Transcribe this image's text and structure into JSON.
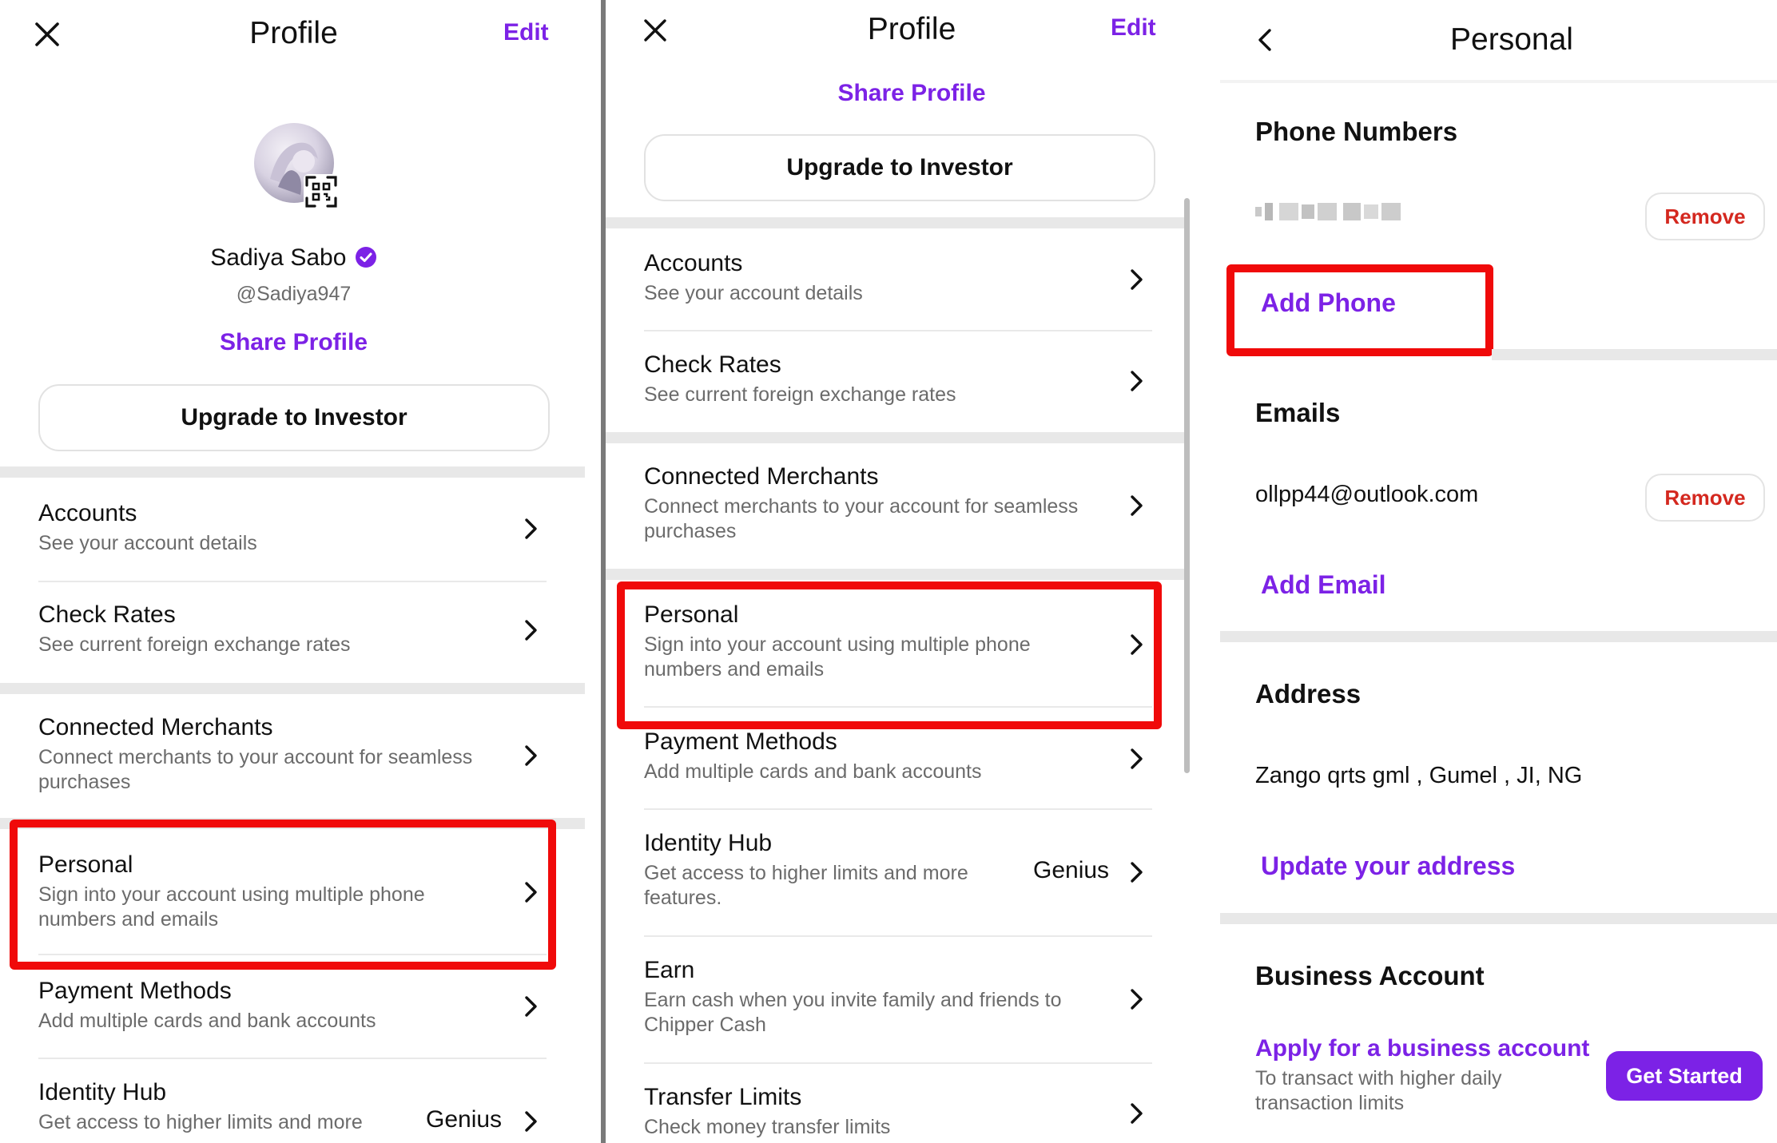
{
  "panel1": {
    "close_icon": "close-icon",
    "title": "Profile",
    "edit_label": "Edit",
    "avatar_icon": "avatar",
    "qr_icon": "qr-code-icon",
    "user_name": "Sadiya Sabo",
    "verified_icon": "verified-badge-icon",
    "username": "@Sadiya947",
    "share_label": "Share Profile",
    "upgrade_label": "Upgrade to Investor",
    "items": [
      {
        "title": "Accounts",
        "subtitle": "See your account details"
      },
      {
        "title": "Check Rates",
        "subtitle": "See current foreign exchange rates"
      },
      {
        "title": "Connected Merchants",
        "subtitle": "Connect merchants to your account for seamless purchases"
      },
      {
        "title": "Personal",
        "subtitle": "Sign into your account using multiple phone numbers and emails"
      },
      {
        "title": "Payment Methods",
        "subtitle": "Add multiple cards and bank accounts"
      },
      {
        "title": "Identity Hub",
        "subtitle": "Get access to higher limits and more",
        "badge": "Genius"
      }
    ]
  },
  "panel2": {
    "title": "Profile",
    "edit_label": "Edit",
    "share_label": "Share Profile",
    "upgrade_label": "Upgrade to Investor",
    "items": [
      {
        "title": "Accounts",
        "subtitle": "See your account details"
      },
      {
        "title": "Check Rates",
        "subtitle": "See current foreign exchange rates"
      },
      {
        "title": "Connected Merchants",
        "subtitle": "Connect merchants to your account for seamless purchases"
      },
      {
        "title": "Personal",
        "subtitle": "Sign into your account using multiple phone numbers and emails"
      },
      {
        "title": "Payment Methods",
        "subtitle": "Add multiple cards and bank accounts"
      },
      {
        "title": "Identity Hub",
        "subtitle": "Get access to higher limits and more features.",
        "badge": "Genius"
      },
      {
        "title": "Earn",
        "subtitle": "Earn cash when you invite family and friends to Chipper Cash"
      },
      {
        "title": "Transfer Limits",
        "subtitle": "Check money transfer limits"
      }
    ]
  },
  "panel3": {
    "back_icon": "back-arrow-icon",
    "title": "Personal",
    "phone_section": "Phone Numbers",
    "remove_label": "Remove",
    "add_phone": "Add Phone",
    "emails_section": "Emails",
    "email": "ollpp44@outlook.com",
    "add_email": "Add Email",
    "address_section": "Address",
    "address": "Zango qrts gml , Gumel , JI, NG",
    "update_address": "Update your address",
    "business_section": "Business Account",
    "business_link": "Apply for a business account",
    "business_sub": "To transact with higher daily transaction limits",
    "get_started": "Get Started"
  },
  "colors": {
    "accent": "#7c22e6",
    "remove_red": "#d4281f",
    "highlight_red": "#f00a0a",
    "band_gray": "#e8e8e8"
  }
}
